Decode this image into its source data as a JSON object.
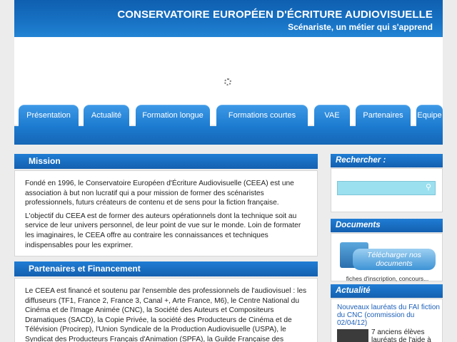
{
  "header": {
    "title": "CONSERVATOIRE EUROPÉEN D'ÉCRITURE AUDIOVISUELLE",
    "subtitle": "Scénariste, un métier qui s'apprend"
  },
  "nav": {
    "tabs": [
      "Présentation",
      "Actualité",
      "Formation longue",
      "Formations courtes",
      "VAE",
      "Partenaires",
      "Equipe"
    ]
  },
  "mission": {
    "heading": "Mission",
    "paragraphs": [
      "Fondé en 1996, le Conservatoire Européen d'Écriture Audiovisuelle (CEEA) est une association à but non lucratif qui a pour mission de former des scénaristes professionnels, futurs créateurs de contenu et de sens pour la fiction française.",
      "L'objectif du CEEA est de former des auteurs opérationnels dont la technique soit au service de leur univers personnel, de leur point de vue sur le monde. Loin de formater les imaginaires, le CEEA offre au contraire les connaissances et techniques indispensables pour les exprimer."
    ]
  },
  "partners": {
    "heading": "Partenaires et Financement",
    "paragraph": "Le CEEA est financé et soutenu par l'ensemble des professionnels de l'audiovisuel : les diffuseurs (TF1, France 2, France 3, Canal +, Arte France, M6), le Centre National du Cinéma et de l'Image Animée (CNC), la Société des Auteurs et Compositeurs Dramatiques (SACD), la Copie Privée, la société des Producteurs de Cinéma et de Télévision (Procirep), l'Union Syndicale de la Production Audiovisuelle (USPA), le Syndicat des Producteurs Français d'Animation (SPFA), la Guilde Française des"
  },
  "sidebar": {
    "search_heading": "Rechercher :",
    "search_value": "",
    "docs_heading": "Documents",
    "docs_button": "Télécharger nos documents",
    "docs_caption": "fiches d'inscription, concours...",
    "news_heading": "Actualité",
    "news_link": "Nouveaux lauréats du FAI fiction du CNC (commission du 02/04/12)",
    "news_text": "7 anciens élèves lauréats de l'aide à"
  }
}
